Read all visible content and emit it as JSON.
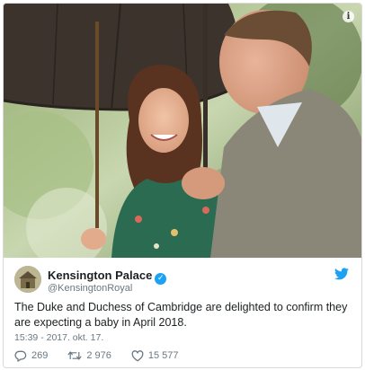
{
  "photo": {
    "alt_icon": "info-icon",
    "info_glyph": "i"
  },
  "tweet": {
    "display_name": "Kensington Palace",
    "verified_glyph": "✓",
    "handle": "@KensingtonRoyal",
    "text": "The Duke and Duchess of Cambridge are delighted to confirm they are expecting a baby in April 2018.",
    "timestamp": "15:39 - 2017. okt. 17.",
    "replies": "269",
    "retweets": "2 976",
    "likes": "15 577"
  },
  "colors": {
    "twitter_blue": "#1da1f2",
    "text": "#1c2022",
    "muted": "#697882"
  }
}
